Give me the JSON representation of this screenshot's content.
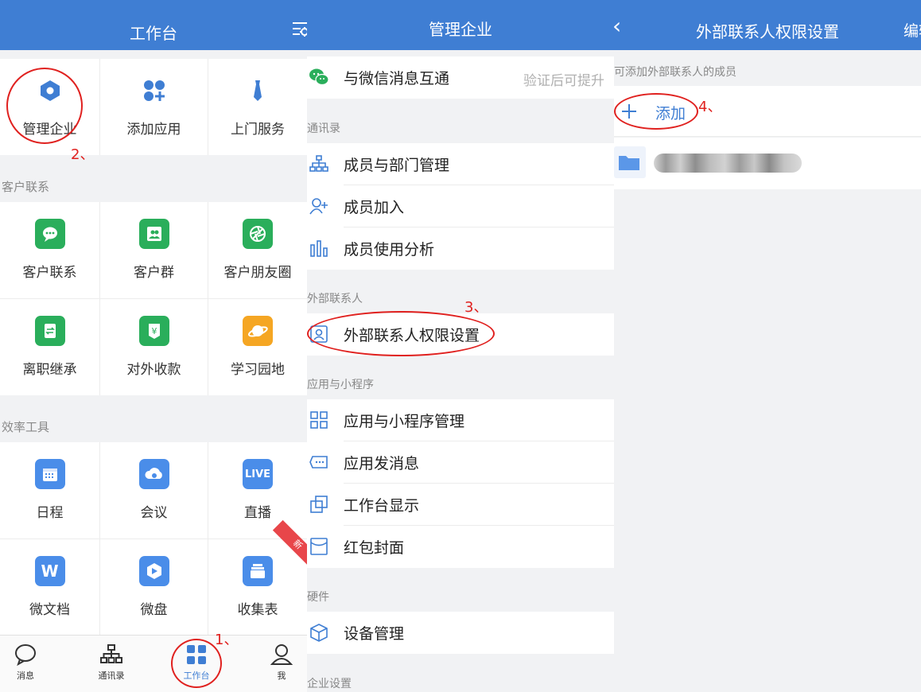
{
  "workbench": {
    "title": "工作台",
    "top_apps": [
      "管理企业",
      "添加应用",
      "上门服务"
    ],
    "customer_section": "客户联系",
    "customer_apps": [
      "客户联系",
      "客户群",
      "客户朋友圈",
      "离职继承",
      "对外收款",
      "学习园地"
    ],
    "efficiency_section": "效率工具",
    "efficiency_apps": [
      "日程",
      "会议",
      "直播",
      "微文档",
      "微盘",
      "收集表"
    ],
    "live_badge": "LIVE",
    "doc_badge": "W",
    "new_ribbon": "新",
    "tabs": [
      "消息",
      "通讯录",
      "工作台",
      "我"
    ]
  },
  "manage": {
    "title": "管理企业",
    "wechat_row": "与微信消息互通",
    "wechat_hint": "验证后可提升",
    "contacts_section": "通讯录",
    "contacts_items": [
      "成员与部门管理",
      "成员加入",
      "成员使用分析"
    ],
    "external_section": "外部联系人",
    "external_items": [
      "外部联系人权限设置"
    ],
    "apps_section": "应用与小程序",
    "apps_items": [
      "应用与小程序管理",
      "应用发消息",
      "工作台显示",
      "红包封面"
    ],
    "hardware_section": "硬件",
    "hardware_items": [
      "设备管理"
    ],
    "enterprise_section": "企业设置"
  },
  "external_perm": {
    "back": "‹",
    "title": "外部联系人权限设置",
    "edit": "编辑",
    "section": "可添加外部联系人的成员",
    "add_label": "添加"
  },
  "annotations": [
    "1、",
    "2、",
    "3、",
    "4、"
  ],
  "colors": {
    "header": "#3f7ed3",
    "green": "#2aae5b",
    "blue": "#4a8de9",
    "orange": "#f5a623",
    "red": "#e0211f"
  }
}
